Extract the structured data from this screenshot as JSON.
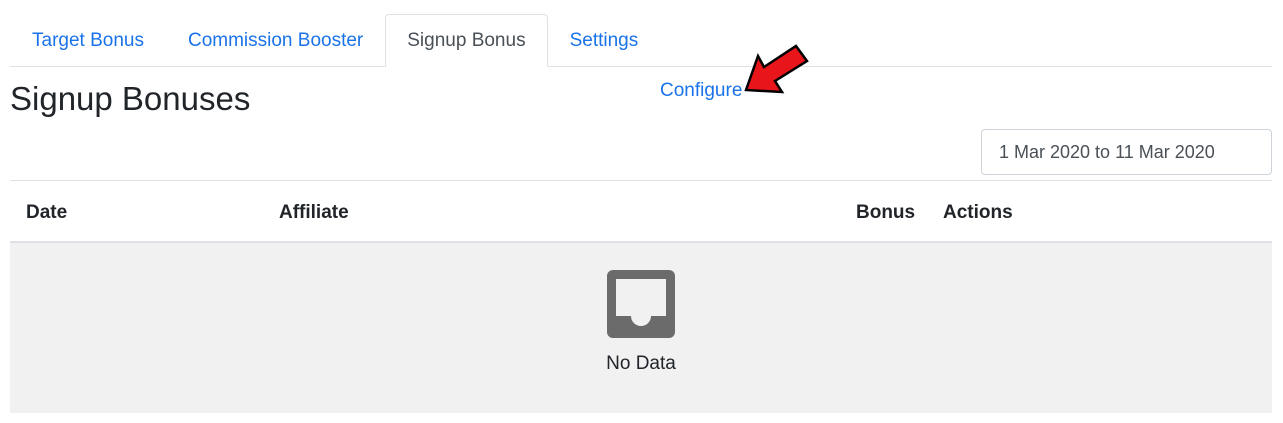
{
  "tabs": [
    {
      "label": "Target Bonus",
      "active": false
    },
    {
      "label": "Commission Booster",
      "active": false
    },
    {
      "label": "Signup Bonus",
      "active": true
    },
    {
      "label": "Settings",
      "active": false
    }
  ],
  "page": {
    "title": "Signup Bonuses",
    "configure_label": "Configure",
    "date_range": "1 Mar 2020 to 11 Mar 2020"
  },
  "table": {
    "columns": [
      "Date",
      "Affiliate",
      "Bonus",
      "Actions"
    ],
    "rows": [],
    "empty_text": "No Data"
  },
  "colors": {
    "link": "#1a73e8",
    "annotation_arrow": "#e8151b",
    "empty_bg": "#f1f1f1",
    "empty_icon": "#6b6b6b"
  },
  "icons": {
    "annotation": "red-arrow-icon",
    "empty_state": "inbox-icon"
  }
}
